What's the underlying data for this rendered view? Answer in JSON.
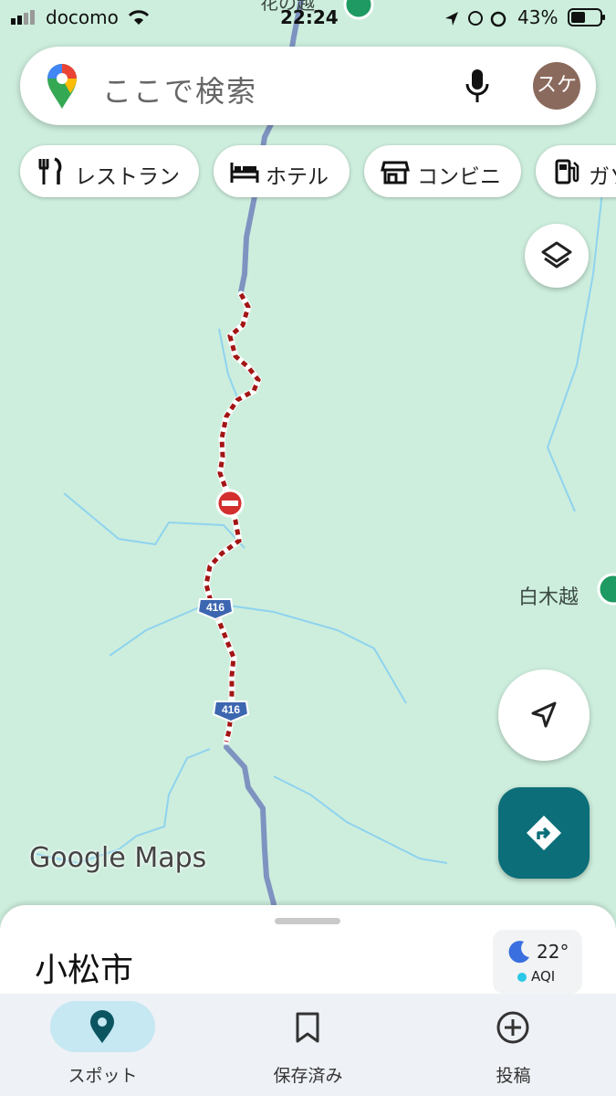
{
  "status_bar": {
    "carrier": "docomo",
    "time": "22:24",
    "battery": "43%"
  },
  "search": {
    "placeholder": "ここで検索",
    "avatar_text": "スケ"
  },
  "chips": [
    {
      "label": "レストラン",
      "icon": "fork-knife-icon"
    },
    {
      "label": "ホテル",
      "icon": "bed-icon"
    },
    {
      "label": "コンビニ",
      "icon": "store-icon"
    },
    {
      "label": "ガソ",
      "icon": "gas-station-icon"
    }
  ],
  "map": {
    "top_label": "花の越",
    "place_label": "白木越",
    "road_shields": [
      "416",
      "416"
    ],
    "watermark": "Google Maps",
    "colors": {
      "land": "#cdeedd",
      "road": "#7f93c1",
      "closure": "#a31515",
      "river": "#8fd3ee",
      "accent": "#0b6e79"
    }
  },
  "sheet": {
    "place": "小松市",
    "temperature": "22°",
    "aqi_label": "AQI"
  },
  "nav": [
    {
      "label": "スポット",
      "icon": "location-pin-icon",
      "active": true
    },
    {
      "label": "保存済み",
      "icon": "bookmark-icon",
      "active": false
    },
    {
      "label": "投稿",
      "icon": "add-circle-icon",
      "active": false
    }
  ]
}
